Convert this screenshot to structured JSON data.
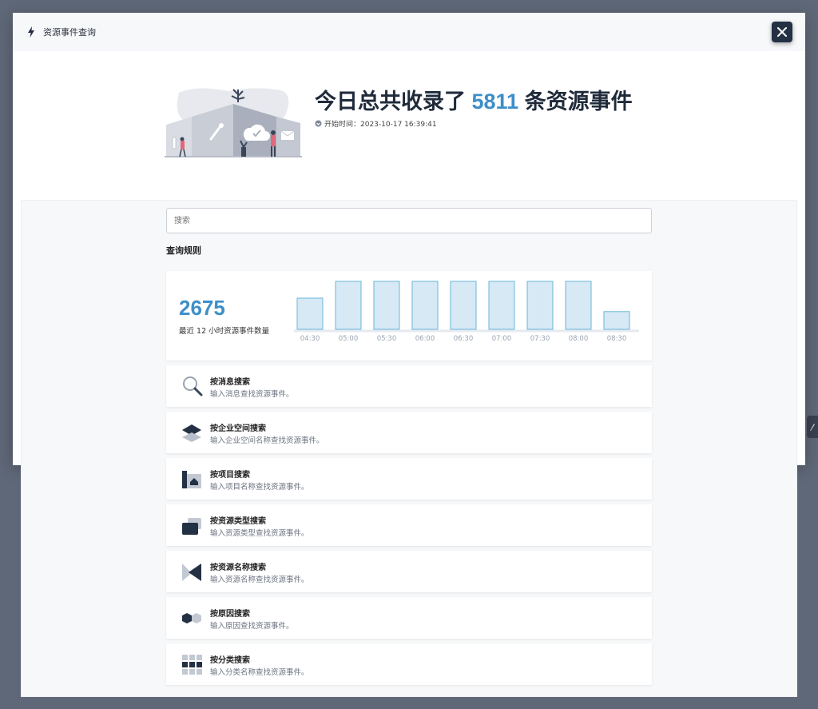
{
  "modal": {
    "title": "资源事件查询",
    "close_label": "×"
  },
  "hero": {
    "headline_prefix": "今日总共收录了",
    "total_count": "5811",
    "headline_suffix": "条资源事件",
    "start_time": "开始时间：2023-10-17 16:39:41"
  },
  "search": {
    "placeholder": "搜索"
  },
  "rules_label": "查询规则",
  "stats": {
    "count": "2675",
    "label": "最近 12 小时资源事件数量"
  },
  "chart_data": {
    "type": "bar",
    "categories": [
      "04:30",
      "05:00",
      "05:30",
      "06:00",
      "06:30",
      "07:00",
      "07:30",
      "08:00",
      "08:30"
    ],
    "values": [
      0.65,
      1.0,
      1.0,
      1.0,
      1.0,
      1.0,
      1.0,
      1.0,
      0.37
    ],
    "title": "",
    "xlabel": "",
    "ylabel": "",
    "colors": {
      "fill": "#d6e9f5",
      "stroke": "#6ab6d9"
    }
  },
  "cards": [
    {
      "title": "按消息搜索",
      "desc": "输入消息查找资源事件。",
      "icon": "magnifier-icon"
    },
    {
      "title": "按企业空间搜索",
      "desc": "输入企业空间名称查找资源事件。",
      "icon": "layers-icon"
    },
    {
      "title": "按项目搜索",
      "desc": "输入项目名称查找资源事件。",
      "icon": "project-icon"
    },
    {
      "title": "按资源类型搜索",
      "desc": "输入资源类型查找资源事件。",
      "icon": "resource-type-icon"
    },
    {
      "title": "按资源名称搜索",
      "desc": "输入资源名称查找资源事件。",
      "icon": "resource-name-icon"
    },
    {
      "title": "按原因搜索",
      "desc": "输入原因查找资源事件。",
      "icon": "hexagons-icon"
    },
    {
      "title": "按分类搜索",
      "desc": "输入分类名称查找资源事件。",
      "icon": "grid-icon"
    }
  ],
  "colors": {
    "accent": "#3d8fc9",
    "dark": "#243044"
  }
}
